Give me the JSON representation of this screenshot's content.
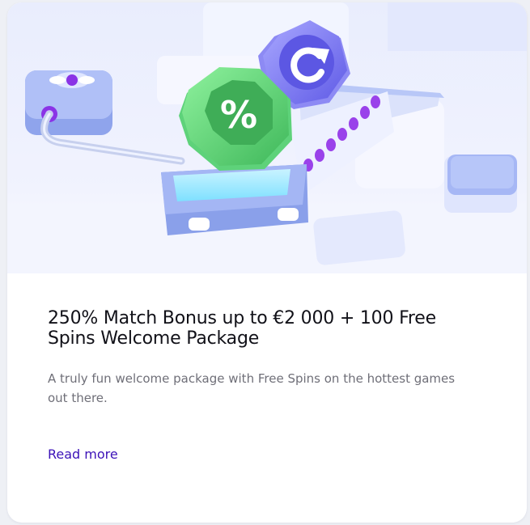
{
  "promo_card": {
    "title_line1": "250% Match Bonus up to €2 000 + 100 Free",
    "title_line2": "Spins Welcome Package",
    "description_line1": "A truly fun welcome package with Free Spins on the hottest games",
    "description_line2": "out there.",
    "read_more_label": "Read more",
    "percent_badge_text": "%",
    "colors": {
      "accent_link": "#3c12b8",
      "badge_green": "#4fcf6e",
      "badge_purple": "#6d63ee",
      "machine_blue": "#8ea5ee"
    },
    "illustration_icons": [
      "percent-badge-icon",
      "refresh-badge-icon",
      "flower-button-icon"
    ]
  }
}
